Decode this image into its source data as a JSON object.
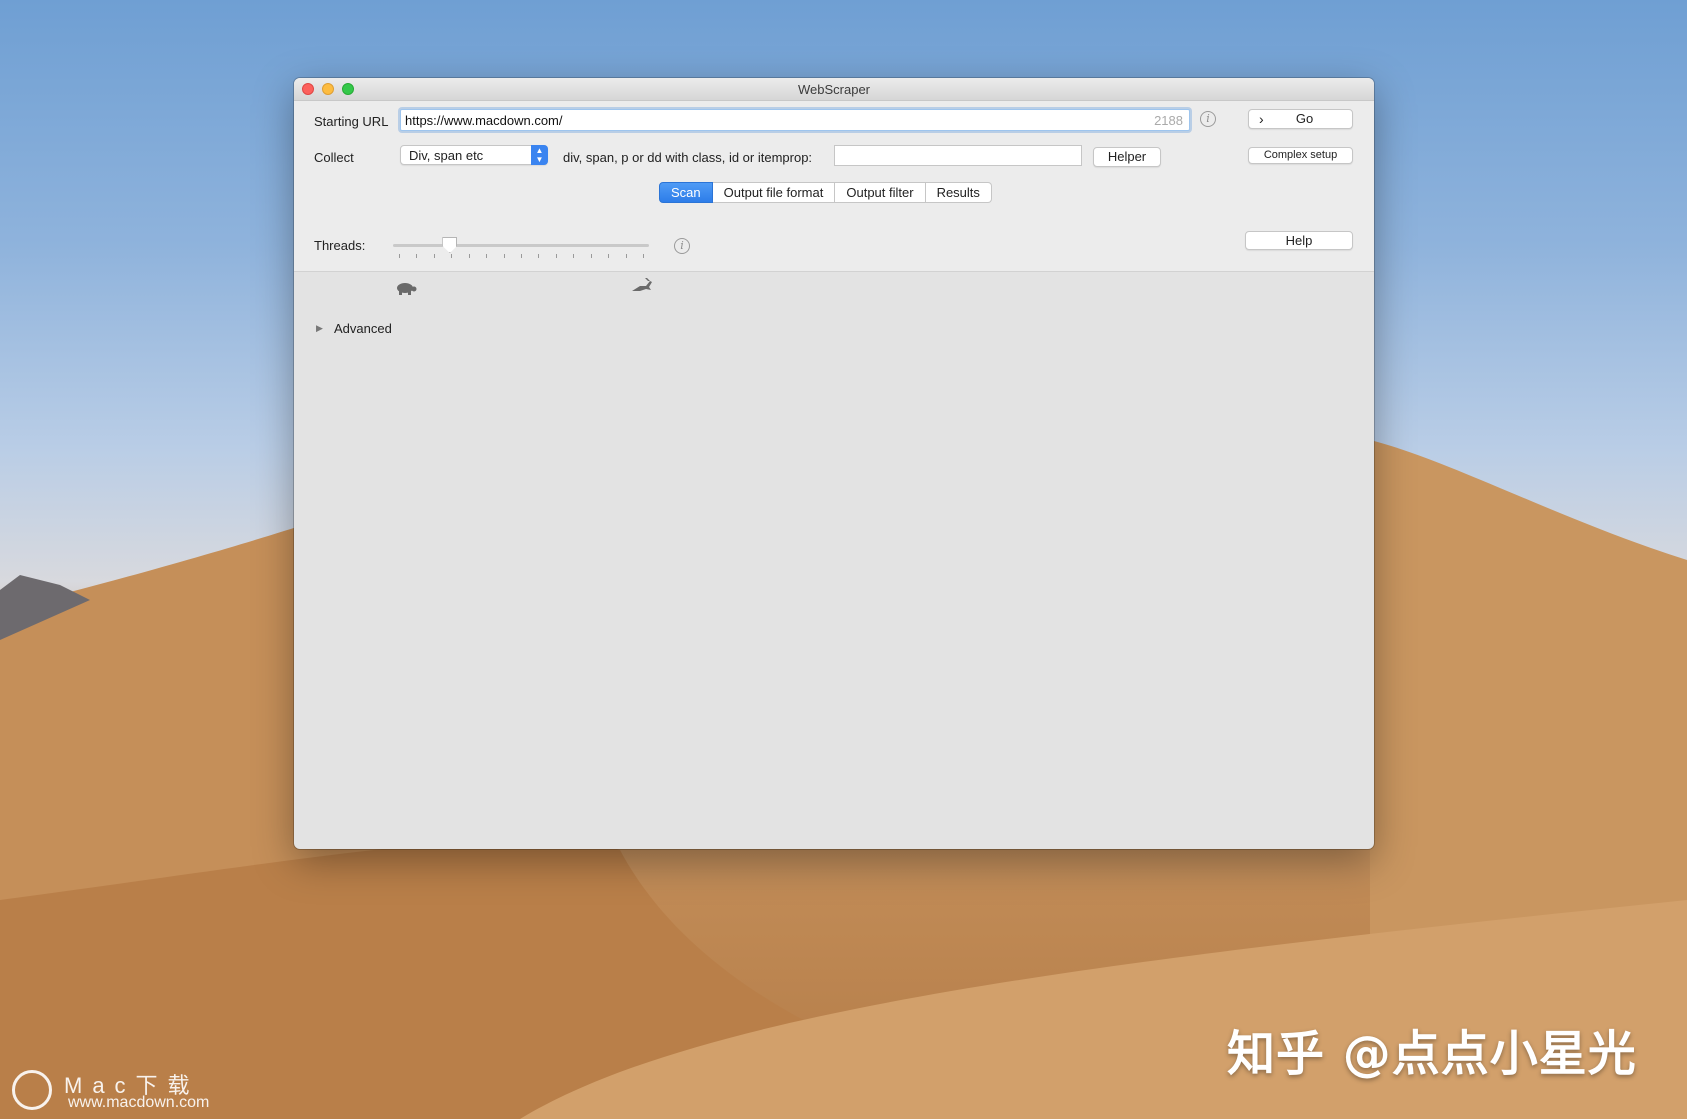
{
  "window": {
    "title": "WebScraper"
  },
  "toolbar": {
    "starting_url_label": "Starting URL",
    "url_value": "https://www.macdown.com/",
    "url_count": "2188",
    "go_label": "Go",
    "collect_label": "Collect",
    "collect_selected": "Div, span etc",
    "class_prompt": "div, span, p or dd with class, id or itemprop:",
    "class_value": "",
    "helper_label": "Helper",
    "complex_setup_label": "Complex setup"
  },
  "tabs": [
    {
      "label": "Scan",
      "active": true
    },
    {
      "label": "Output file format",
      "active": false
    },
    {
      "label": "Output filter",
      "active": false
    },
    {
      "label": "Results",
      "active": false
    }
  ],
  "scan": {
    "threads_label": "Threads:",
    "threads_level": 0.22,
    "slow_icon": "turtle-icon",
    "fast_icon": "rabbit-icon",
    "help_label": "Help",
    "advanced_label": "Advanced"
  },
  "watermarks": {
    "zhihu": "知乎 @点点小星光",
    "mac_name": "Mac下载",
    "mac_site": "www.macdown.com"
  },
  "colors": {
    "accent": "#2d7de9",
    "close": "#fc605c",
    "minimize": "#fdbc40",
    "maximize": "#34c84a"
  }
}
